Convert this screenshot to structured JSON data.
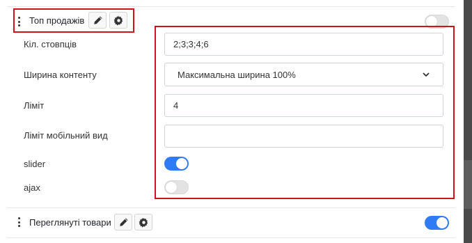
{
  "colors": {
    "highlight": "#d0131b",
    "toggle_on": "#2f7bf5",
    "toggle_off": "#e3e3e3"
  },
  "modules": [
    {
      "title": "Топ продажів",
      "enabled": false,
      "icons": [
        "pencil-icon",
        "gear-icon"
      ]
    },
    {
      "title": "Переглянуті товари",
      "enabled": true,
      "icons": [
        "pencil-icon",
        "gear-icon"
      ]
    }
  ],
  "settings": {
    "columns": {
      "label": "Кіл. стовпців",
      "value": "2;3;3;4;6"
    },
    "content_width": {
      "label": "Ширина контенту",
      "selected": "Максимальна ширина 100%"
    },
    "limit": {
      "label": "Ліміт",
      "value": "4"
    },
    "limit_mobile": {
      "label": "Ліміт мобільний вид",
      "value": ""
    },
    "slider": {
      "label": "slider",
      "enabled": true
    },
    "ajax": {
      "label": "ajax",
      "enabled": false
    }
  }
}
